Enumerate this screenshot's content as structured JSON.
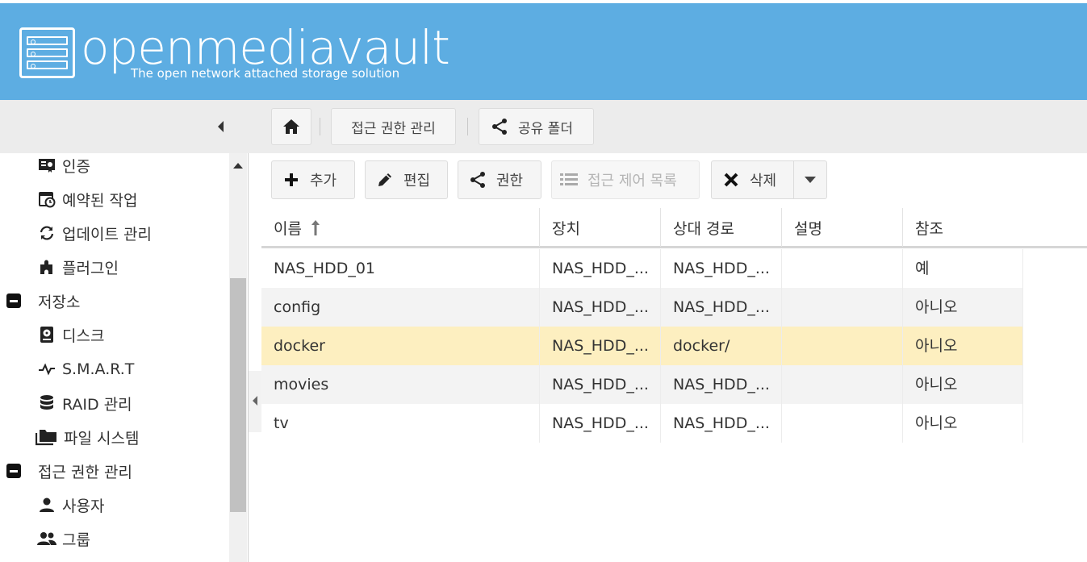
{
  "app": {
    "title": "openmediavault",
    "subtitle": "The open network attached storage solution"
  },
  "breadcrumb": {
    "items": [
      "접근 권한 관리",
      "공유 폴더"
    ]
  },
  "sidebar": {
    "items": [
      {
        "label": "인증",
        "icon": "certificate-icon"
      },
      {
        "label": "예약된 작업",
        "icon": "calendar-clock-icon"
      },
      {
        "label": "업데이트 관리",
        "icon": "sync-icon"
      },
      {
        "label": "플러그인",
        "icon": "puzzle-icon"
      },
      {
        "label": "저장소",
        "icon": "collapse-icon",
        "group": true
      },
      {
        "label": "디스크",
        "icon": "harddisk-icon"
      },
      {
        "label": "S.M.A.R.T",
        "icon": "pulse-icon"
      },
      {
        "label": "RAID 관리",
        "icon": "database-icon"
      },
      {
        "label": "파일 시스템",
        "icon": "folders-icon"
      },
      {
        "label": "접근 권한 관리",
        "icon": "collapse-icon",
        "group": true
      },
      {
        "label": "사용자",
        "icon": "user-icon"
      },
      {
        "label": "그룹",
        "icon": "users-icon"
      }
    ]
  },
  "toolbar": {
    "add": "추가",
    "edit": "편집",
    "permissions": "권한",
    "acl": "접근 제어 목록",
    "delete": "삭제"
  },
  "table": {
    "columns": [
      "이름",
      "장치",
      "상대 경로",
      "설명",
      "참조"
    ],
    "sort_icon": "sort-asc-icon",
    "rows": [
      [
        "NAS_HDD_01",
        "NAS_HDD_...",
        "NAS_HDD_...",
        "",
        "예"
      ],
      [
        "config",
        "NAS_HDD_...",
        "NAS_HDD_...",
        "",
        "아니오"
      ],
      [
        "docker",
        "NAS_HDD_...",
        "docker/",
        "",
        "아니오"
      ],
      [
        "movies",
        "NAS_HDD_...",
        "NAS_HDD_...",
        "",
        "아니오"
      ],
      [
        "tv",
        "NAS_HDD_...",
        "NAS_HDD_...",
        "",
        "아니오"
      ]
    ],
    "selected_row": 2
  },
  "colors": {
    "header_bg": "#5dade2",
    "row_alt": "#f3f3f3",
    "row_selected": "#fdefc0"
  }
}
